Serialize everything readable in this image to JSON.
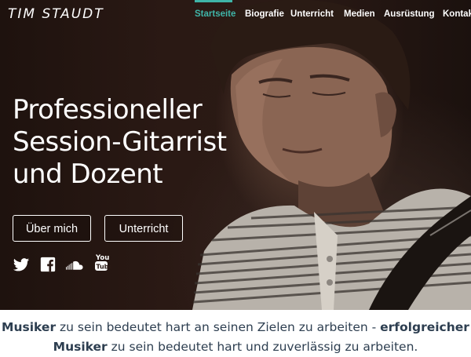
{
  "brand": {
    "logo_text": "TIM STAUDT"
  },
  "nav": {
    "items": [
      {
        "label": "Startseite",
        "active": true
      },
      {
        "label": "Biografie",
        "active": false
      },
      {
        "label": "Unterricht",
        "active": false
      },
      {
        "label": "Medien",
        "active": false
      },
      {
        "label": "Ausrüstung",
        "active": false
      },
      {
        "label": "Kontakt",
        "active": false
      }
    ],
    "active_color": "#3fb5a8"
  },
  "hero": {
    "headline_lines": [
      "Professioneller",
      "Session-Gitarrist",
      "und Dozent"
    ],
    "buttons": {
      "about_label": "Über mich",
      "lessons_label": "Unterricht"
    },
    "social_icons": [
      "twitter-icon",
      "facebook-icon",
      "soundcloud-icon",
      "youtube-icon"
    ]
  },
  "intro": {
    "part1_bold": "Musiker",
    "part2": " zu sein bedeutet hart an seinen Zielen zu arbeiten - ",
    "part3_bold": "erfolgreicher Musiker",
    "part4": " zu sein bedeutet hart und zuverlässig zu arbeiten."
  },
  "colors": {
    "accent": "#3fb5a8",
    "text_dark": "#2d3e50"
  }
}
